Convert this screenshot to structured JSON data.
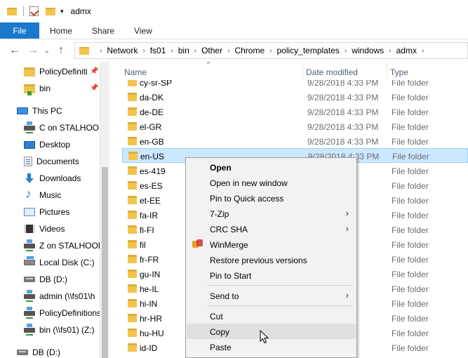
{
  "titlebar": {
    "title": "admx",
    "dropdown_glyph": "▾"
  },
  "ribbon": {
    "tabs": [
      {
        "label": "File"
      },
      {
        "label": "Home"
      },
      {
        "label": "Share"
      },
      {
        "label": "View"
      }
    ]
  },
  "nav": {
    "back_glyph": "←",
    "forward_glyph": "→",
    "recent_glyph": "⌄",
    "up_glyph": "↑",
    "breadcrumbs": [
      "Network",
      "fs01",
      "bin",
      "Other",
      "Chrome",
      "policy_templates",
      "windows",
      "admx"
    ],
    "crumb_separator": "›"
  },
  "sidebar": {
    "items": [
      {
        "label": "PolicyDefiniti",
        "icon": "folder-icon",
        "pinned": true
      },
      {
        "label": "bin",
        "icon": "folder-green-icon",
        "pinned": true
      },
      {
        "label": "This PC",
        "icon": "computer-icon"
      },
      {
        "label": "C on STALHOOD",
        "icon": "network-drive-icon"
      },
      {
        "label": "Desktop",
        "icon": "desktop-icon"
      },
      {
        "label": "Documents",
        "icon": "documents-icon"
      },
      {
        "label": "Downloads",
        "icon": "downloads-icon"
      },
      {
        "label": "Music",
        "icon": "music-icon"
      },
      {
        "label": "Pictures",
        "icon": "pictures-icon"
      },
      {
        "label": "Videos",
        "icon": "videos-icon"
      },
      {
        "label": "Z on STALHOOD",
        "icon": "network-drive-icon"
      },
      {
        "label": "Local Disk (C:)",
        "icon": "local-disk-icon"
      },
      {
        "label": "DB (D:)",
        "icon": "dvd-drive-icon"
      },
      {
        "label": "admin (\\\\fs01\\h",
        "icon": "network-drive-icon"
      },
      {
        "label": "PolicyDefinitions",
        "icon": "network-drive-icon"
      },
      {
        "label": "bin (\\\\fs01) (Z:)",
        "icon": "network-drive-icon"
      },
      {
        "label": "DB (D:)",
        "icon": "dvd-drive-icon"
      }
    ],
    "pin_glyph": "📌"
  },
  "columns": {
    "name": "Name",
    "date": "Date modified",
    "type": "Type",
    "sort_glyph": "^"
  },
  "files": [
    {
      "name": "cy-sr-SP",
      "date": "9/28/2018 4:33 PM",
      "type": "File folder"
    },
    {
      "name": "da-DK",
      "date": "9/28/2018 4:33 PM",
      "type": "File folder"
    },
    {
      "name": "de-DE",
      "date": "9/28/2018 4:33 PM",
      "type": "File folder"
    },
    {
      "name": "el-GR",
      "date": "9/28/2018 4:33 PM",
      "type": "File folder"
    },
    {
      "name": "en-GB",
      "date": "9/28/2018 4:33 PM",
      "type": "File folder"
    },
    {
      "name": "en-US",
      "date": "9/28/2018 4:33 PM",
      "type": "File folder",
      "selected": true
    },
    {
      "name": "es-419",
      "date": "",
      "type": "File folder"
    },
    {
      "name": "es-ES",
      "date": "",
      "type": "File folder"
    },
    {
      "name": "et-EE",
      "date": "",
      "type": "File folder"
    },
    {
      "name": "fa-IR",
      "date": "",
      "type": "File folder"
    },
    {
      "name": "fi-FI",
      "date": "",
      "type": "File folder"
    },
    {
      "name": "fil",
      "date": "",
      "type": "File folder"
    },
    {
      "name": "fr-FR",
      "date": "",
      "type": "File folder"
    },
    {
      "name": "gu-IN",
      "date": "",
      "type": "File folder"
    },
    {
      "name": "he-IL",
      "date": "",
      "type": "File folder"
    },
    {
      "name": "hi-IN",
      "date": "",
      "type": "File folder"
    },
    {
      "name": "hr-HR",
      "date": "",
      "type": "File folder"
    },
    {
      "name": "hu-HU",
      "date": "",
      "type": "File folder"
    },
    {
      "name": "id-ID",
      "date": "",
      "type": "File folder"
    }
  ],
  "context_menu": {
    "items": [
      {
        "label": "Open",
        "bold": true
      },
      {
        "label": "Open in new window"
      },
      {
        "label": "Pin to Quick access"
      },
      {
        "label": "7-Zip",
        "submenu": true
      },
      {
        "label": "CRC SHA",
        "submenu": true
      },
      {
        "label": "WinMerge",
        "icon": "winmerge-icon"
      },
      {
        "label": "Restore previous versions"
      },
      {
        "label": "Pin to Start"
      },
      {
        "label": "Send to",
        "submenu": true
      },
      {
        "label": "Cut"
      },
      {
        "label": "Copy",
        "hover": true
      },
      {
        "label": "Paste"
      }
    ],
    "submenu_glyph": "›"
  },
  "colors": {
    "accent": "#1979ca",
    "selection": "#cce8ff",
    "folder": "#f3c44b"
  }
}
